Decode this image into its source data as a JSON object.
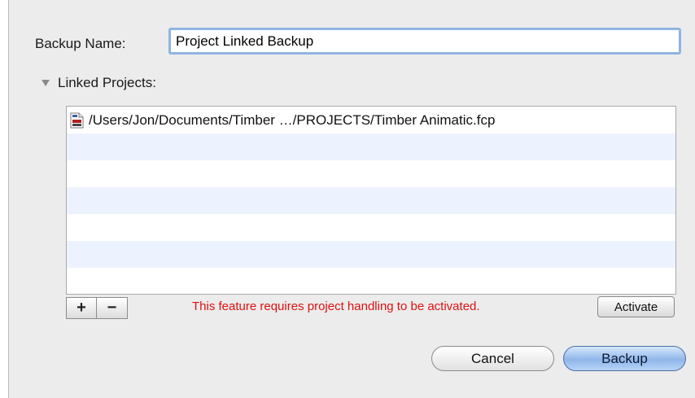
{
  "dialog": {
    "backup_name_label": "Backup Name:",
    "backup_name_value": "Project Linked Backup",
    "linked_projects_label": "Linked Projects:",
    "list_rows": [
      "/Users/Jon/Documents/Timber …/PROJECTS/Timber Animatic.fcp",
      "",
      "",
      "",
      "",
      "",
      ""
    ],
    "add_label": "+",
    "remove_label": "−",
    "warning_text": "This feature requires project handling to be activated.",
    "activate_label": "Activate",
    "cancel_label": "Cancel",
    "backup_label": "Backup"
  },
  "colors": {
    "warning": "#e01010",
    "row_stripe": "#edf3fe",
    "focus_ring": "#8fb4e3",
    "default_button": "#8fb6ea"
  },
  "icons": {
    "disclosure": "disclosure-triangle-expanded",
    "project_file": "fcp-document-icon"
  }
}
